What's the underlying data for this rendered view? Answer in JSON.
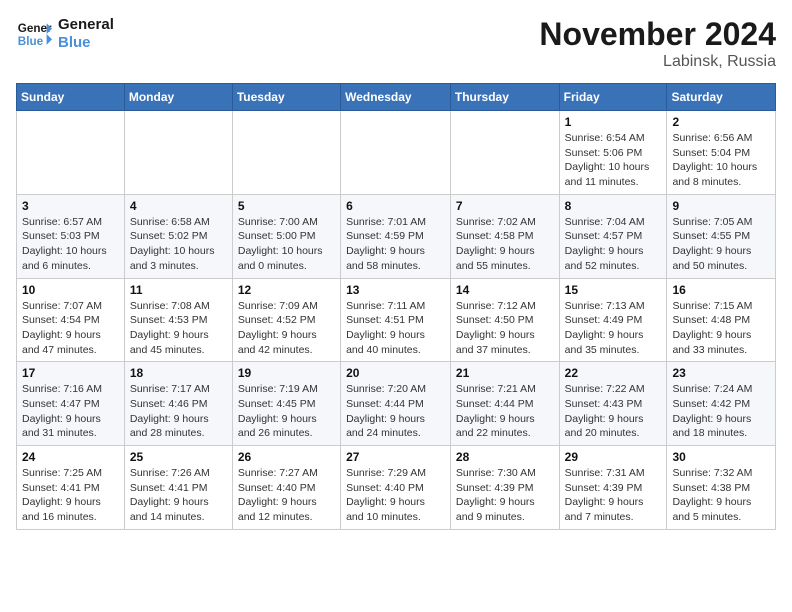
{
  "logo": {
    "line1": "General",
    "line2": "Blue"
  },
  "title": "November 2024",
  "location": "Labinsk, Russia",
  "days_of_week": [
    "Sunday",
    "Monday",
    "Tuesday",
    "Wednesday",
    "Thursday",
    "Friday",
    "Saturday"
  ],
  "weeks": [
    [
      {
        "day": "",
        "info": ""
      },
      {
        "day": "",
        "info": ""
      },
      {
        "day": "",
        "info": ""
      },
      {
        "day": "",
        "info": ""
      },
      {
        "day": "",
        "info": ""
      },
      {
        "day": "1",
        "info": "Sunrise: 6:54 AM\nSunset: 5:06 PM\nDaylight: 10 hours and 11 minutes."
      },
      {
        "day": "2",
        "info": "Sunrise: 6:56 AM\nSunset: 5:04 PM\nDaylight: 10 hours and 8 minutes."
      }
    ],
    [
      {
        "day": "3",
        "info": "Sunrise: 6:57 AM\nSunset: 5:03 PM\nDaylight: 10 hours and 6 minutes."
      },
      {
        "day": "4",
        "info": "Sunrise: 6:58 AM\nSunset: 5:02 PM\nDaylight: 10 hours and 3 minutes."
      },
      {
        "day": "5",
        "info": "Sunrise: 7:00 AM\nSunset: 5:00 PM\nDaylight: 10 hours and 0 minutes."
      },
      {
        "day": "6",
        "info": "Sunrise: 7:01 AM\nSunset: 4:59 PM\nDaylight: 9 hours and 58 minutes."
      },
      {
        "day": "7",
        "info": "Sunrise: 7:02 AM\nSunset: 4:58 PM\nDaylight: 9 hours and 55 minutes."
      },
      {
        "day": "8",
        "info": "Sunrise: 7:04 AM\nSunset: 4:57 PM\nDaylight: 9 hours and 52 minutes."
      },
      {
        "day": "9",
        "info": "Sunrise: 7:05 AM\nSunset: 4:55 PM\nDaylight: 9 hours and 50 minutes."
      }
    ],
    [
      {
        "day": "10",
        "info": "Sunrise: 7:07 AM\nSunset: 4:54 PM\nDaylight: 9 hours and 47 minutes."
      },
      {
        "day": "11",
        "info": "Sunrise: 7:08 AM\nSunset: 4:53 PM\nDaylight: 9 hours and 45 minutes."
      },
      {
        "day": "12",
        "info": "Sunrise: 7:09 AM\nSunset: 4:52 PM\nDaylight: 9 hours and 42 minutes."
      },
      {
        "day": "13",
        "info": "Sunrise: 7:11 AM\nSunset: 4:51 PM\nDaylight: 9 hours and 40 minutes."
      },
      {
        "day": "14",
        "info": "Sunrise: 7:12 AM\nSunset: 4:50 PM\nDaylight: 9 hours and 37 minutes."
      },
      {
        "day": "15",
        "info": "Sunrise: 7:13 AM\nSunset: 4:49 PM\nDaylight: 9 hours and 35 minutes."
      },
      {
        "day": "16",
        "info": "Sunrise: 7:15 AM\nSunset: 4:48 PM\nDaylight: 9 hours and 33 minutes."
      }
    ],
    [
      {
        "day": "17",
        "info": "Sunrise: 7:16 AM\nSunset: 4:47 PM\nDaylight: 9 hours and 31 minutes."
      },
      {
        "day": "18",
        "info": "Sunrise: 7:17 AM\nSunset: 4:46 PM\nDaylight: 9 hours and 28 minutes."
      },
      {
        "day": "19",
        "info": "Sunrise: 7:19 AM\nSunset: 4:45 PM\nDaylight: 9 hours and 26 minutes."
      },
      {
        "day": "20",
        "info": "Sunrise: 7:20 AM\nSunset: 4:44 PM\nDaylight: 9 hours and 24 minutes."
      },
      {
        "day": "21",
        "info": "Sunrise: 7:21 AM\nSunset: 4:44 PM\nDaylight: 9 hours and 22 minutes."
      },
      {
        "day": "22",
        "info": "Sunrise: 7:22 AM\nSunset: 4:43 PM\nDaylight: 9 hours and 20 minutes."
      },
      {
        "day": "23",
        "info": "Sunrise: 7:24 AM\nSunset: 4:42 PM\nDaylight: 9 hours and 18 minutes."
      }
    ],
    [
      {
        "day": "24",
        "info": "Sunrise: 7:25 AM\nSunset: 4:41 PM\nDaylight: 9 hours and 16 minutes."
      },
      {
        "day": "25",
        "info": "Sunrise: 7:26 AM\nSunset: 4:41 PM\nDaylight: 9 hours and 14 minutes."
      },
      {
        "day": "26",
        "info": "Sunrise: 7:27 AM\nSunset: 4:40 PM\nDaylight: 9 hours and 12 minutes."
      },
      {
        "day": "27",
        "info": "Sunrise: 7:29 AM\nSunset: 4:40 PM\nDaylight: 9 hours and 10 minutes."
      },
      {
        "day": "28",
        "info": "Sunrise: 7:30 AM\nSunset: 4:39 PM\nDaylight: 9 hours and 9 minutes."
      },
      {
        "day": "29",
        "info": "Sunrise: 7:31 AM\nSunset: 4:39 PM\nDaylight: 9 hours and 7 minutes."
      },
      {
        "day": "30",
        "info": "Sunrise: 7:32 AM\nSunset: 4:38 PM\nDaylight: 9 hours and 5 minutes."
      }
    ]
  ]
}
